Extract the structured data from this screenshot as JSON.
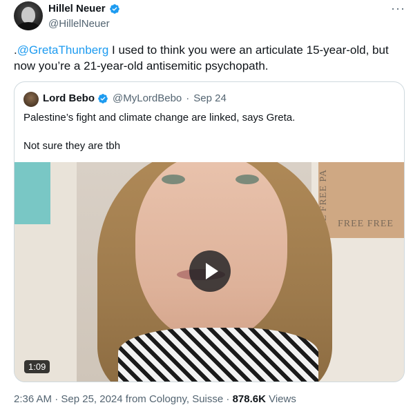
{
  "author": {
    "display_name": "Hillel Neuer",
    "handle": "@HillelNeuer"
  },
  "more_icon": "···",
  "tweet": {
    "prefix": ".",
    "mention": "@GretaThunberg",
    "text": " I used to think you were an articulate 15-year-old, but now you’re a 21-year-old antisemitic psychopath."
  },
  "quote": {
    "display_name": "Lord Bebo",
    "handle": "@MyLordBebo",
    "separator": "·",
    "date": "Sep 24",
    "text_line1": "Palestine’s fight and climate change are linked, says Greta.",
    "text_line2": "Not sure they are tbh",
    "video": {
      "duration": "1:09",
      "poster_text_vertical": "FREE FREE PA",
      "poster_text_horizontal": "FREE  FREE"
    }
  },
  "footer": {
    "time": "2:36 AM · Sep 25, 2024 from Cologny, Suisse · ",
    "views_count": "878.6K",
    "views_label": " Views"
  },
  "colors": {
    "accent": "#1d9bf0",
    "text": "#0f1419",
    "muted": "#536471",
    "border": "#cfd9de"
  }
}
